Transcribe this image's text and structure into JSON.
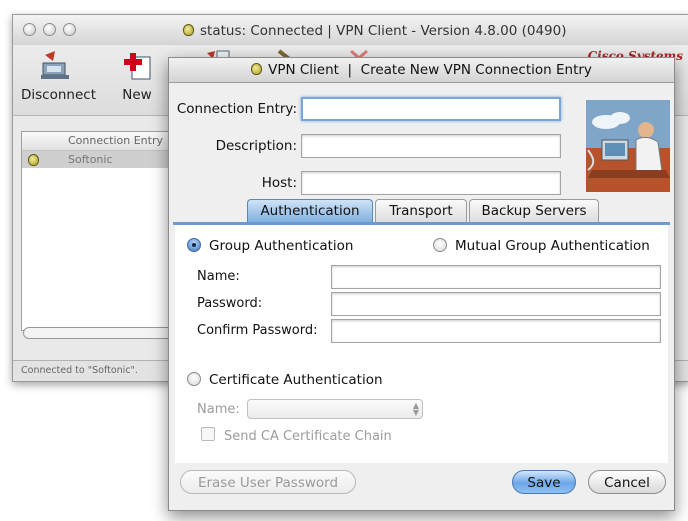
{
  "main_window": {
    "title": "status: Connected | VPN Client - Version 4.8.00 (0490)",
    "toolbar": {
      "disconnect_label": "Disconnect",
      "new_label": "New"
    },
    "brand": "Cisco Systems",
    "list": {
      "column_header": "Connection Entry",
      "entries": [
        "Softonic"
      ]
    },
    "status_text": "Connected to \"Softonic\"."
  },
  "dialog": {
    "title": "VPN Client  |  Create New VPN Connection Entry",
    "connection_entry_label": "Connection Entry:",
    "connection_entry_value": "",
    "description_label": "Description:",
    "description_value": "",
    "host_label": "Host:",
    "host_value": "",
    "tabs": [
      {
        "label": "Authentication",
        "active": true
      },
      {
        "label": "Transport",
        "active": false
      },
      {
        "label": "Backup Servers",
        "active": false
      }
    ],
    "auth": {
      "group_auth_label": "Group Authentication",
      "mutual_group_auth_label": "Mutual Group Authentication",
      "selected": "group",
      "name_label": "Name:",
      "password_label": "Password:",
      "confirm_password_label": "Confirm Password:",
      "certificate_auth_label": "Certificate Authentication",
      "cert_name_label": "Name:",
      "cert_name_value": "",
      "send_ca_chain_label": "Send CA Certificate Chain"
    },
    "buttons": {
      "erase_password": "Erase User Password",
      "save": "Save",
      "cancel": "Cancel"
    }
  },
  "colors": {
    "accent_blue": "#6a9bd0",
    "brand_red": "#b22222"
  }
}
